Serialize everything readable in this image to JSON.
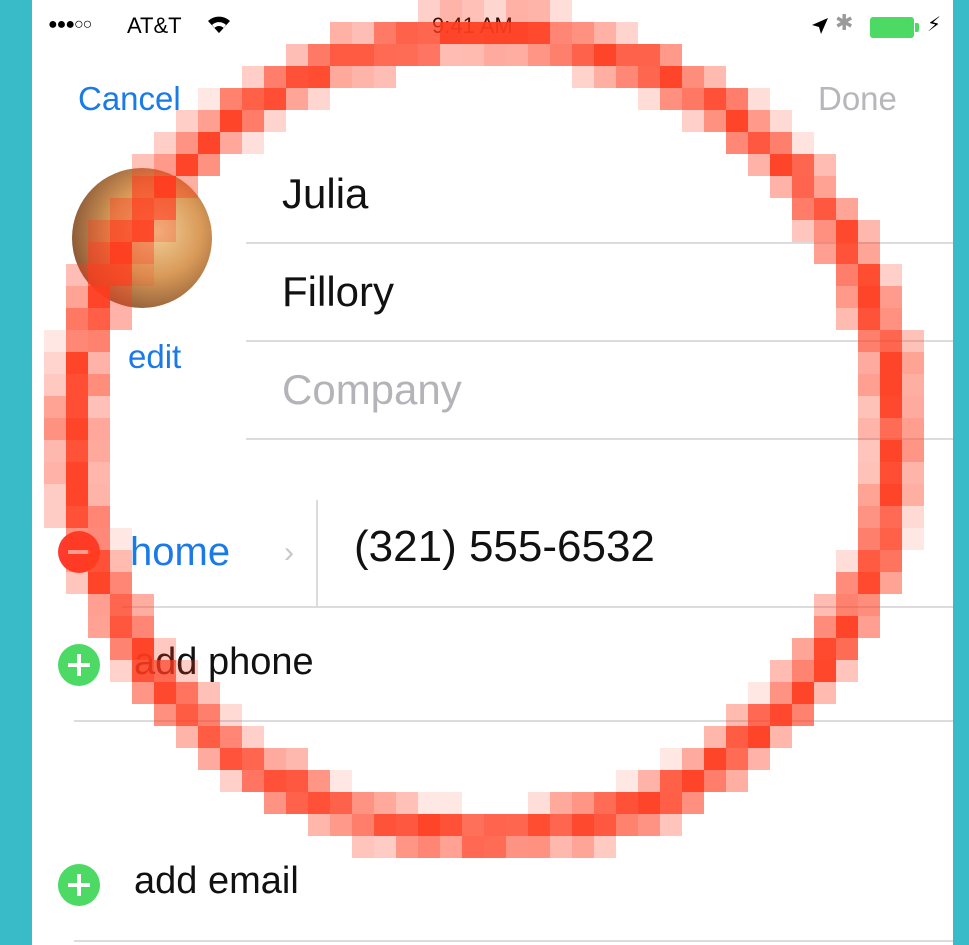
{
  "status_bar": {
    "signal": "●●●○○",
    "carrier": "AT&T",
    "time": "9:41 AM",
    "bluetooth": "✱",
    "charging": "⚡"
  },
  "nav": {
    "cancel_label": "Cancel",
    "done_label": "Done"
  },
  "photo": {
    "edit_label": "edit"
  },
  "name_fields": {
    "first_name": "Julia",
    "last_name": "Fillory",
    "company_placeholder": "Company"
  },
  "phone_entry": {
    "label": "home",
    "number": "(321) 555-6532"
  },
  "add_phone_label": "add phone",
  "add_email_label": "add email",
  "colors": {
    "accent_blue": "#1a7ae8",
    "add_green": "#4cd964",
    "remove_red": "#ff3b30",
    "ring_red": "#ff3b1e",
    "background_teal": "#39bcc8"
  },
  "icons": {
    "wifi": "wifi-icon",
    "location": "location-arrow-icon",
    "bluetooth": "bluetooth-icon",
    "battery": "battery-icon",
    "remove": "remove-circle-icon",
    "add": "add-circle-icon",
    "chevron": "chevron-right-icon"
  }
}
